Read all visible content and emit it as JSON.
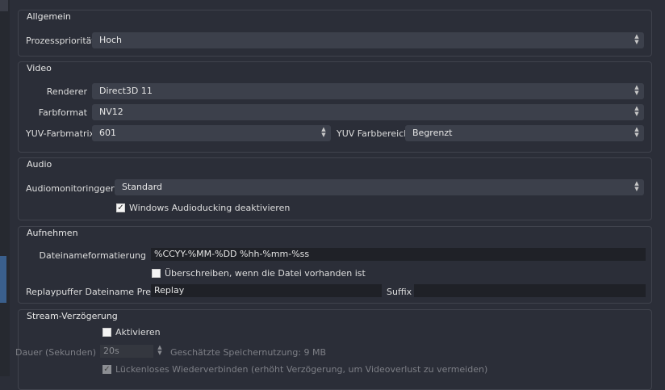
{
  "general": {
    "title": "Allgemein",
    "priority_label": "Prozesspriorität",
    "priority_value": "Hoch"
  },
  "video": {
    "title": "Video",
    "renderer_label": "Renderer",
    "renderer_value": "Direct3D 11",
    "color_format_label": "Farbformat",
    "color_format_value": "NV12",
    "yuv_matrix_label": "YUV-Farbmatrix",
    "yuv_matrix_value": "601",
    "yuv_range_label": "YUV Farbbereich",
    "yuv_range_value": "Begrenzt"
  },
  "audio": {
    "title": "Audio",
    "monitoring_label": "Audiomonitoringgerät",
    "monitoring_value": "Standard",
    "ducking_label": "Windows Audioducking deaktivieren",
    "ducking_checked": true
  },
  "recording": {
    "title": "Aufnehmen",
    "filename_format_label": "Dateinameformatierung",
    "filename_format_value": "%CCYY-%MM-%DD %hh-%mm-%ss",
    "overwrite_label": "Überschreiben, wenn die Datei vorhanden ist",
    "overwrite_checked": false,
    "replay_prefix_label": "Replaypuffer Dateiname Prefix",
    "replay_prefix_value": "Replay",
    "suffix_label": "Suffix",
    "suffix_value": ""
  },
  "stream_delay": {
    "title": "Stream-Verzögerung",
    "enable_label": "Aktivieren",
    "enable_checked": false,
    "duration_label": "Dauer (Sekunden)",
    "duration_value": "20s",
    "memory_label": "Geschätzte Speichernutzung: 9 MB",
    "reconnect_label": "Lückenloses Wiederverbinden (erhöht Verzögerung, um Videoverlust zu vermeiden)",
    "reconnect_checked": true
  },
  "icons": {
    "check": "✓",
    "up": "▲",
    "down": "▼"
  }
}
